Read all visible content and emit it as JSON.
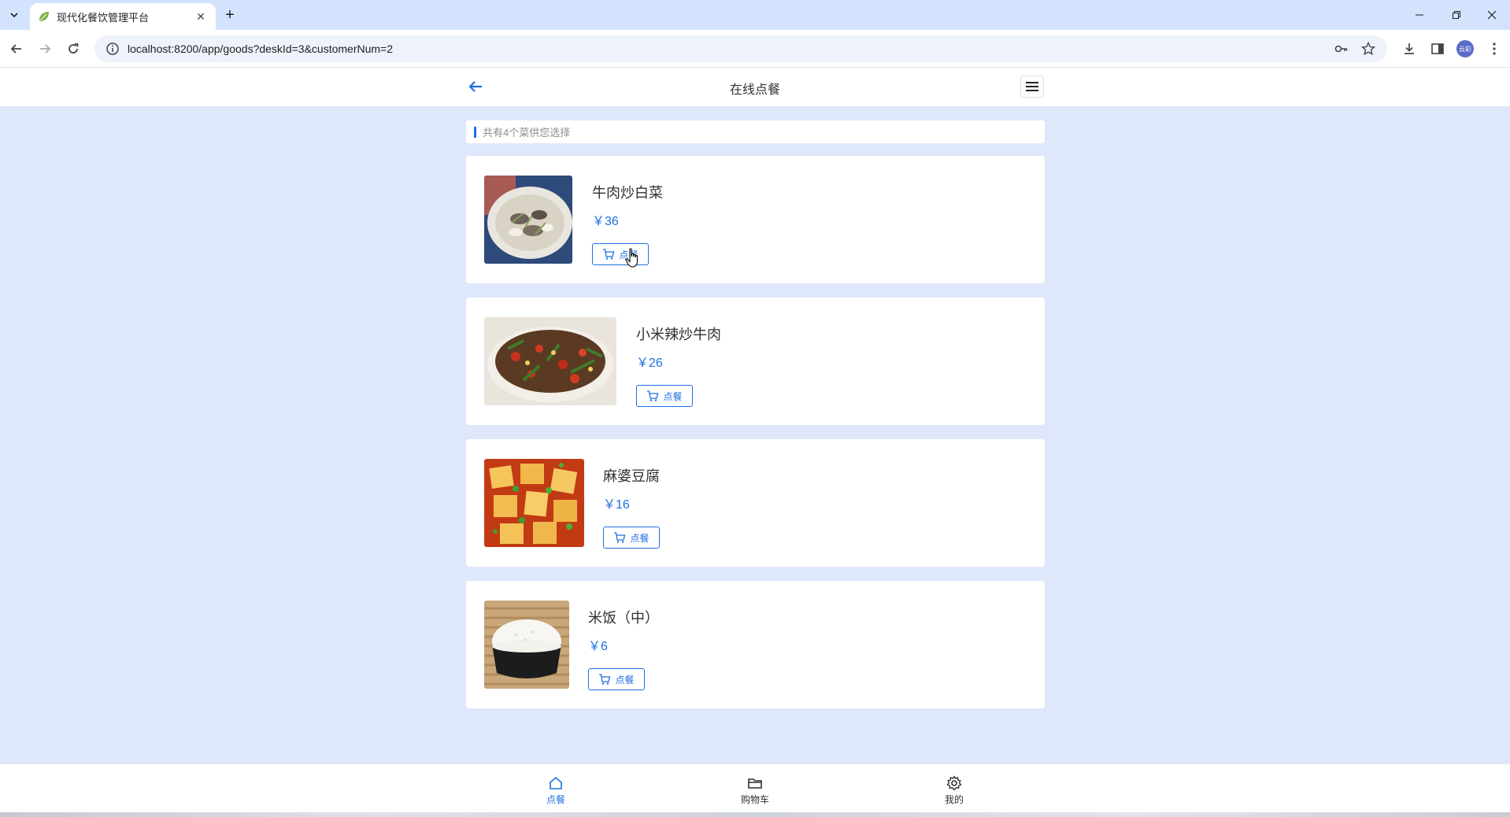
{
  "browser": {
    "tab_title": "现代化餐饮管理平台",
    "url": "localhost:8200/app/goods?deskId=3&customerNum=2",
    "profile_initials": "云彩"
  },
  "header": {
    "title": "在线点餐"
  },
  "info": {
    "text": "共有4个菜供您选择"
  },
  "dishes": [
    {
      "name": "牛肉炒白菜",
      "price": "￥36",
      "order_label": "点餐"
    },
    {
      "name": "小米辣炒牛肉",
      "price": "￥26",
      "order_label": "点餐"
    },
    {
      "name": "麻婆豆腐",
      "price": "￥16",
      "order_label": "点餐"
    },
    {
      "name": "米饭（中）",
      "price": "￥6",
      "order_label": "点餐"
    }
  ],
  "bottom_nav": [
    {
      "label": "点餐",
      "icon": "home-icon",
      "active": true
    },
    {
      "label": "购物车",
      "icon": "folder-icon",
      "active": false
    },
    {
      "label": "我的",
      "icon": "gear-icon",
      "active": false
    }
  ],
  "colors": {
    "accent": "#1e6fe0",
    "page_bg": "#dfe7fb",
    "tabbar_bg": "#d3e3fd"
  }
}
